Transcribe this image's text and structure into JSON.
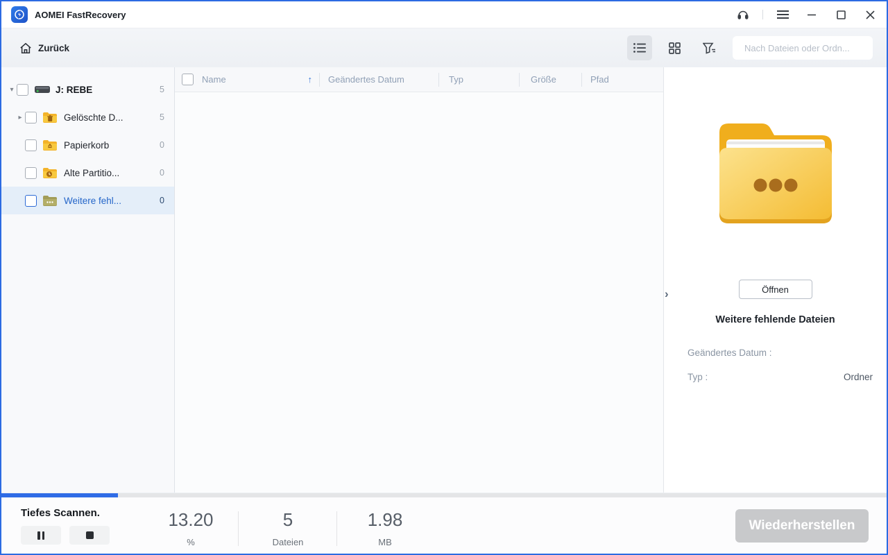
{
  "titlebar": {
    "title": "AOMEI FastRecovery"
  },
  "toolbar": {
    "back_label": "Zurück",
    "search_placeholder": "Nach Dateien oder Ordn..."
  },
  "icons": {
    "caret_down": "▾",
    "caret_right": "▸",
    "sort_up": "↑",
    "chevron_right": "›"
  },
  "sidebar": {
    "items": [
      {
        "label": "J: REBE",
        "count": "5",
        "icon": "drive-icon",
        "state": "expanded"
      },
      {
        "label": "Gelöschte D...",
        "count": "5",
        "icon": "folder-trash-icon",
        "state": "collapsed"
      },
      {
        "label": "Papierkorb",
        "count": "0",
        "icon": "folder-recycle-icon",
        "state": "leaf"
      },
      {
        "label": "Alte Partitio...",
        "count": "0",
        "icon": "folder-clock-icon",
        "state": "leaf"
      },
      {
        "label": "Weitere fehl...",
        "count": "0",
        "icon": "folder-more-icon",
        "state": "selected"
      }
    ]
  },
  "table": {
    "columns": [
      "Name",
      "Geändertes Datum",
      "Typ",
      "Größe",
      "Pfad"
    ]
  },
  "panel": {
    "open_button": "Öffnen",
    "title": "Weitere fehlende Dateien",
    "fields": [
      {
        "label": "Geändertes Datum :",
        "value": ""
      },
      {
        "label": "Typ :",
        "value": "Ordner"
      }
    ]
  },
  "status": {
    "scan_label": "Tiefes Scannen.",
    "progress_percent": 13.2,
    "stats": [
      {
        "value": "13.20",
        "unit": "%"
      },
      {
        "value": "5",
        "unit": "Dateien"
      },
      {
        "value": "1.98",
        "unit": "MB"
      }
    ],
    "recover_label": "Wiederherstellen"
  },
  "colors": {
    "accent": "#2f6ce6",
    "window_border": "#2c6be2",
    "selected_row": "#e4eef9",
    "folder_yellow": "#f6bf2f",
    "disabled_button": "#c8c9cb"
  }
}
